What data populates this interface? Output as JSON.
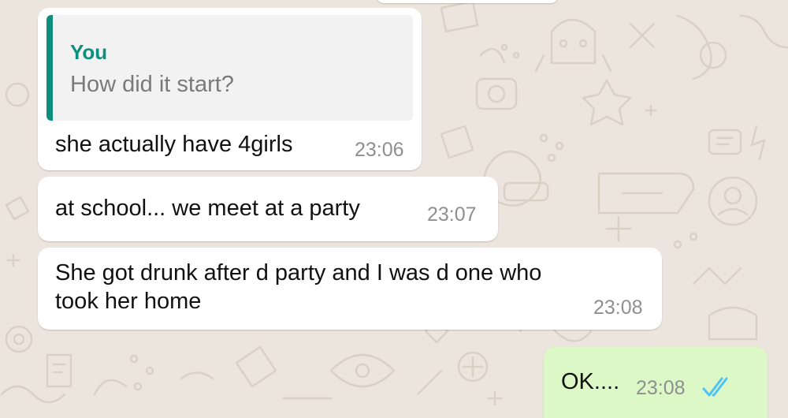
{
  "colors": {
    "wallpaper": "#ece5dd",
    "incoming_bubble": "#ffffff",
    "outgoing_bubble": "#dcf8c6",
    "quote_accent": "#0e8f7e",
    "read_ticks": "#4fc3f7"
  },
  "messages": [
    {
      "direction": "incoming",
      "quote": {
        "author": "You",
        "text": "How did it start?"
      },
      "text": "she actually have 4girls",
      "time": "23:06"
    },
    {
      "direction": "incoming",
      "text": "at school... we meet at a party",
      "time": "23:07"
    },
    {
      "direction": "incoming",
      "lines": [
        "She got drunk after d party and I was d one who",
        "took her home"
      ],
      "time": "23:08"
    },
    {
      "direction": "outgoing",
      "text": "OK....",
      "time": "23:08",
      "status_icon": "double-check-read-icon"
    }
  ]
}
